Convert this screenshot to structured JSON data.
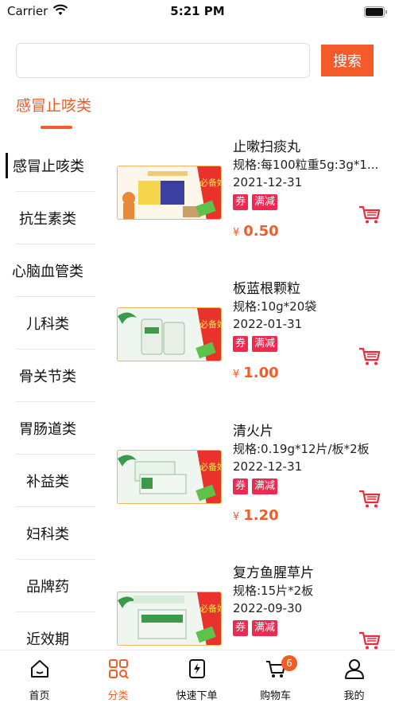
{
  "status_bar": {
    "carrier": "Carrier",
    "time": "5:21 PM"
  },
  "search": {
    "value": "",
    "placeholder": "",
    "button_label": "搜索"
  },
  "category_title": "感冒止咳类",
  "sidebar": {
    "items": [
      {
        "label": "感冒止咳类",
        "active": true
      },
      {
        "label": "抗生素类"
      },
      {
        "label": "心脑血管类"
      },
      {
        "label": "儿科类"
      },
      {
        "label": "骨关节类"
      },
      {
        "label": "胃肠道类"
      },
      {
        "label": "补益类"
      },
      {
        "label": "妇科类"
      },
      {
        "label": "品牌药"
      },
      {
        "label": "近效期"
      }
    ]
  },
  "products": [
    {
      "name": "止嗽扫痰丸",
      "spec": "规格:每100粒重5g:3g*1...",
      "date": "2021-12-31",
      "tags": [
        "券",
        "满减"
      ],
      "currency": "¥",
      "price": "0.50",
      "image_badge": "必备好货"
    },
    {
      "name": "板蓝根颗粒",
      "spec": "规格:10g*20袋",
      "date": "2022-01-31",
      "tags": [
        "券",
        "满减"
      ],
      "currency": "¥",
      "price": "1.00",
      "image_badge": "必备好货"
    },
    {
      "name": "清火片",
      "spec": "规格:0.19g*12片/板*2板",
      "date": "2022-12-31",
      "tags": [
        "券",
        "满减"
      ],
      "currency": "¥",
      "price": "1.20",
      "image_badge": "必备好货"
    },
    {
      "name": "复方鱼腥草片",
      "spec": "规格:15片*2板",
      "date": "2022-09-30",
      "tags": [
        "券",
        "满减"
      ],
      "currency": "¥",
      "price": "",
      "image_badge": "必备好货"
    }
  ],
  "tab_bar": {
    "tabs": [
      {
        "label": "首页",
        "icon": "home-icon"
      },
      {
        "label": "分类",
        "icon": "category-icon",
        "active": true
      },
      {
        "label": "快速下单",
        "icon": "quick-order-icon"
      },
      {
        "label": "购物车",
        "icon": "cart-icon",
        "badge": "6"
      },
      {
        "label": "我的",
        "icon": "profile-icon"
      }
    ]
  },
  "colors": {
    "accent": "#f25c27",
    "tag": "#ee2a50",
    "search_button": "#f45a2a"
  }
}
